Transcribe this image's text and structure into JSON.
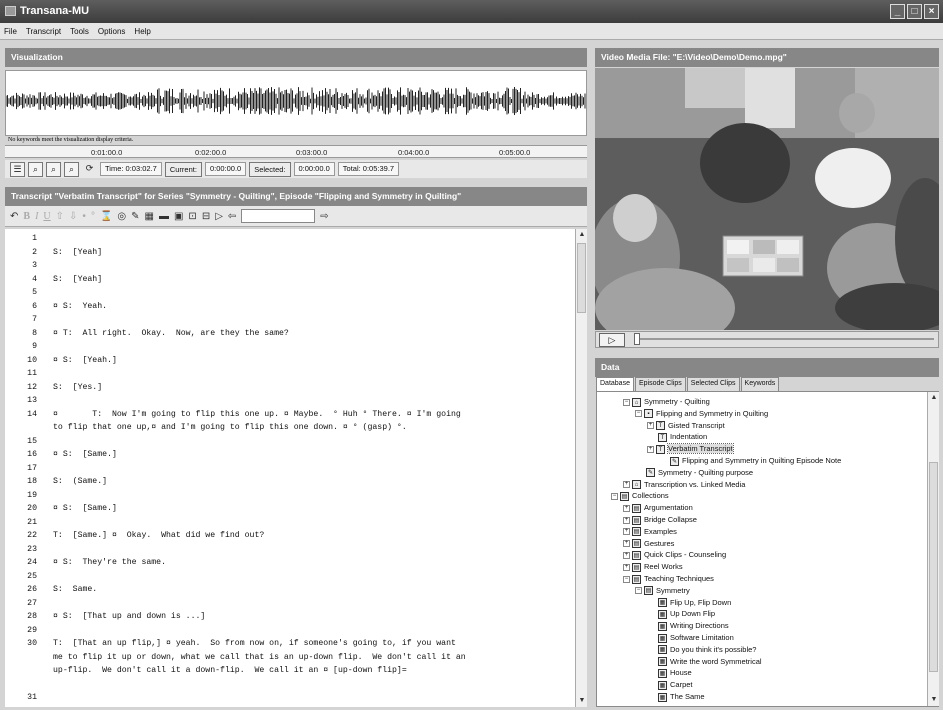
{
  "window": {
    "title": "Transana-MU",
    "minimize_icon": "minimize-icon",
    "maximize_icon": "maximize-icon",
    "close_icon": "close-icon"
  },
  "menu": [
    "File",
    "Transcript",
    "Tools",
    "Options",
    "Help"
  ],
  "visualization": {
    "title": "Visualization",
    "keyword_message": "No keywords meet the visualization display criteria.",
    "ticks": [
      "0:01:00.0",
      "0:02:00.0",
      "0:03:00.0",
      "0:04:00.0",
      "0:05:00.0"
    ],
    "time_label": "Time: 0:03:02.7",
    "current_label": "Current:",
    "current_value": "0:00:00.0",
    "selected_label": "Selected:",
    "selected_value": "0:00:00.0",
    "total_label": "Total: 0:05:39.7"
  },
  "transcript": {
    "title": "Transcript \"Verbatim Transcript\" for Series \"Symmetry - Quilting\", Episode \"Flipping and Symmetry in Quilting\"",
    "lines": [
      {
        "n": "1",
        "t": ""
      },
      {
        "n": "2",
        "t": "S:  [Yeah]"
      },
      {
        "n": "3",
        "t": ""
      },
      {
        "n": "4",
        "t": "S:  [Yeah]"
      },
      {
        "n": "5",
        "t": ""
      },
      {
        "n": "6",
        "t": "¤ S:  Yeah."
      },
      {
        "n": "7",
        "t": ""
      },
      {
        "n": "8",
        "t": "¤ T:  All right.  Okay.  Now, are they the same?"
      },
      {
        "n": "9",
        "t": ""
      },
      {
        "n": "10",
        "t": "¤ S:  [Yeah.]"
      },
      {
        "n": "11",
        "t": ""
      },
      {
        "n": "12",
        "t": "S:  [Yes.]"
      },
      {
        "n": "13",
        "t": ""
      },
      {
        "n": "14",
        "t": "¤       T:  Now I'm going to flip this one up. ¤ Maybe.  ° Huh ° There. ¤ I'm going"
      },
      {
        "n": "",
        "t": "to flip that one up,¤ and I'm going to flip this one down. ¤ ° (gasp) °."
      },
      {
        "n": "15",
        "t": ""
      },
      {
        "n": "16",
        "t": "¤ S:  [Same.]"
      },
      {
        "n": "17",
        "t": ""
      },
      {
        "n": "18",
        "t": "S:  (Same.]"
      },
      {
        "n": "19",
        "t": ""
      },
      {
        "n": "20",
        "t": "¤ S:  [Same.]"
      },
      {
        "n": "21",
        "t": ""
      },
      {
        "n": "22",
        "t": "T:  [Same.] ¤  Okay.  What did we find out?"
      },
      {
        "n": "23",
        "t": ""
      },
      {
        "n": "24",
        "t": "¤ S:  They're the same."
      },
      {
        "n": "25",
        "t": ""
      },
      {
        "n": "26",
        "t": "S:  Same."
      },
      {
        "n": "27",
        "t": ""
      },
      {
        "n": "28",
        "t": "¤ S:  [That up and down is ...]"
      },
      {
        "n": "29",
        "t": ""
      },
      {
        "n": "30",
        "t": "T:  [That an up flip,] ¤ yeah.  So from now on, if someone's going to, if you want"
      },
      {
        "n": "",
        "t": "me to flip it up or down, what we call that is an up-down flip.  We don't call it an"
      },
      {
        "n": "",
        "t": "up-flip.  We don't call it a down-flip.  We call it an ¤ [up-down flip]="
      },
      {
        "n": "",
        "t": ""
      },
      {
        "n": "31",
        "t": ""
      }
    ]
  },
  "video": {
    "title": "Video Media File: \"E:\\Video\\Demo\\Demo.mpg\"",
    "play_icon": "play-icon"
  },
  "data": {
    "title": "Data",
    "tabs": [
      "Database",
      "Episode Clips",
      "Selected Clips",
      "Keywords"
    ],
    "tree": [
      {
        "label": "Symmetry - Quilting",
        "level": 2,
        "exp": "-",
        "icon": "series-icon"
      },
      {
        "label": "Flipping and Symmetry in Quilting",
        "level": 3,
        "exp": "-",
        "icon": "episode-icon"
      },
      {
        "label": "Gisted Transcript",
        "level": 4,
        "exp": "+",
        "icon": "transcript-icon"
      },
      {
        "label": "Indentation",
        "level": 4,
        "exp": "",
        "icon": "transcript-icon"
      },
      {
        "label": "Verbatim Transcript",
        "level": 4,
        "exp": "+",
        "icon": "transcript-icon",
        "selected": true
      },
      {
        "label": "Flipping and Symmetry in Quilting Episode Note",
        "level": 5,
        "exp": "",
        "icon": "note-icon"
      },
      {
        "label": "Symmetry - Quilting purpose",
        "level": 3,
        "exp": "",
        "icon": "note-icon"
      },
      {
        "label": "Transcription vs. Linked Media",
        "level": 2,
        "exp": "+",
        "icon": "series-icon"
      },
      {
        "label": "Collections",
        "level": 1,
        "exp": "-",
        "icon": "collection-icon"
      },
      {
        "label": "Argumentation",
        "level": 2,
        "exp": "+",
        "icon": "collection-icon"
      },
      {
        "label": "Bridge Collapse",
        "level": 2,
        "exp": "+",
        "icon": "collection-icon"
      },
      {
        "label": "Examples",
        "level": 2,
        "exp": "+",
        "icon": "collection-icon"
      },
      {
        "label": "Gestures",
        "level": 2,
        "exp": "+",
        "icon": "collection-icon"
      },
      {
        "label": "Quick Clips - Counseling",
        "level": 2,
        "exp": "+",
        "icon": "collection-icon"
      },
      {
        "label": "Reel Works",
        "level": 2,
        "exp": "+",
        "icon": "collection-icon"
      },
      {
        "label": "Teaching Techniques",
        "level": 2,
        "exp": "-",
        "icon": "collection-icon"
      },
      {
        "label": "Symmetry",
        "level": 3,
        "exp": "-",
        "icon": "collection-icon"
      },
      {
        "label": "Flip Up, Flip Down",
        "level": 4,
        "exp": "",
        "icon": "clip-icon"
      },
      {
        "label": "Up Down Flip",
        "level": 4,
        "exp": "",
        "icon": "clip-icon"
      },
      {
        "label": "Writing Directions",
        "level": 4,
        "exp": "",
        "icon": "clip-icon"
      },
      {
        "label": "Software Limitation",
        "level": 4,
        "exp": "",
        "icon": "clip-icon"
      },
      {
        "label": "Do you think it's possible?",
        "level": 4,
        "exp": "",
        "icon": "clip-icon"
      },
      {
        "label": "Write the word Symmetrical",
        "level": 4,
        "exp": "",
        "icon": "clip-icon"
      },
      {
        "label": "House",
        "level": 4,
        "exp": "",
        "icon": "clip-icon"
      },
      {
        "label": "Carpet",
        "level": 4,
        "exp": "",
        "icon": "clip-icon"
      },
      {
        "label": "The Same",
        "level": 4,
        "exp": "",
        "icon": "clip-icon"
      }
    ]
  }
}
